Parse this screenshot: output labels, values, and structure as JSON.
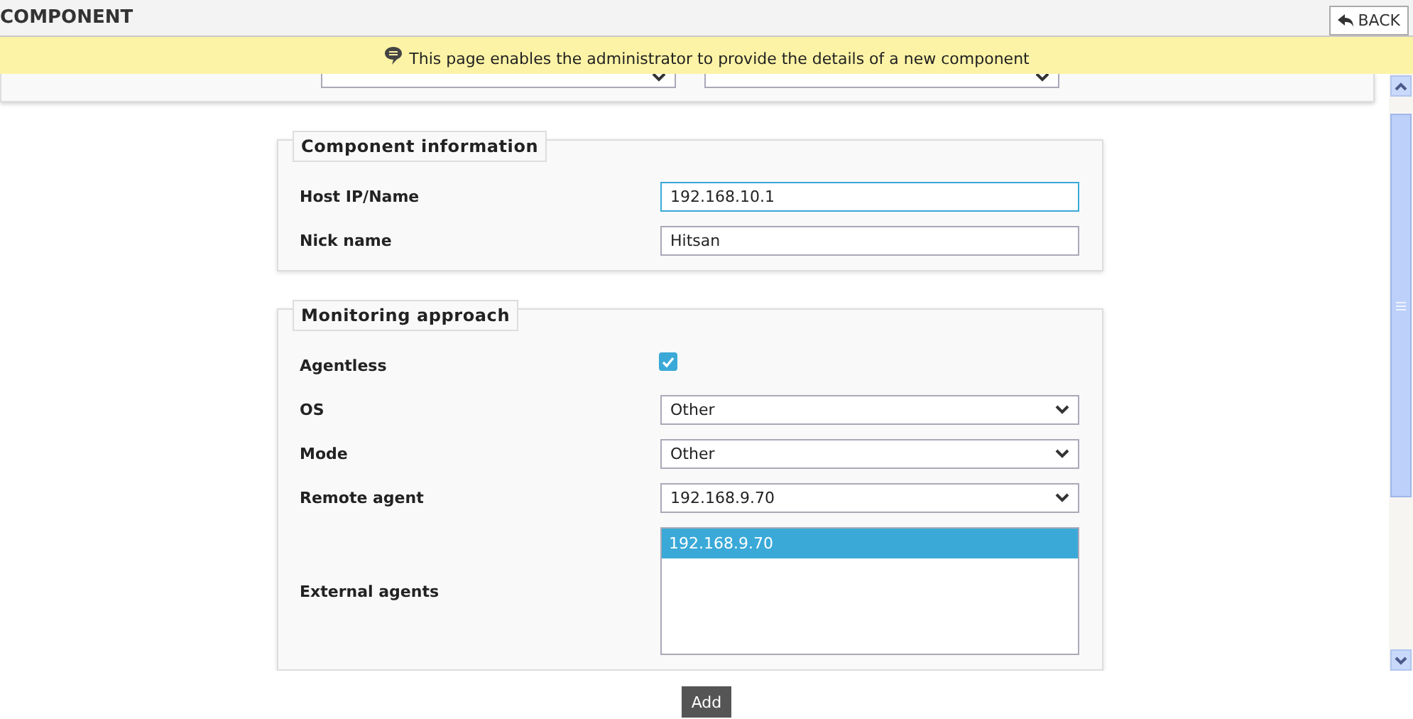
{
  "header": {
    "title": "COMPONENT",
    "back_button": "BACK"
  },
  "banner": {
    "message": "This page enables the administrator to provide the details of a new component"
  },
  "filters": [
    {
      "kind": "select"
    },
    {
      "kind": "select"
    }
  ],
  "sections": [
    {
      "title": "Component information",
      "fields": [
        {
          "kind": "text",
          "label": "Host IP/Name",
          "value": "192.168.10.1",
          "focused": true
        },
        {
          "kind": "text",
          "label": "Nick name",
          "value": "Hitsan",
          "focused": false
        }
      ]
    },
    {
      "title": "Monitoring approach",
      "fields": [
        {
          "kind": "checkbox",
          "label": "Agentless",
          "checked": true
        },
        {
          "kind": "select",
          "label": "OS",
          "value": "Other"
        },
        {
          "kind": "select",
          "label": "Mode",
          "value": "Other"
        },
        {
          "kind": "select",
          "label": "Remote agent",
          "value": "192.168.9.70"
        },
        {
          "kind": "list",
          "label": "External agents",
          "options": [
            {
              "label": "192.168.9.70",
              "selected": true
            }
          ]
        }
      ]
    }
  ],
  "add_button": "Add"
}
